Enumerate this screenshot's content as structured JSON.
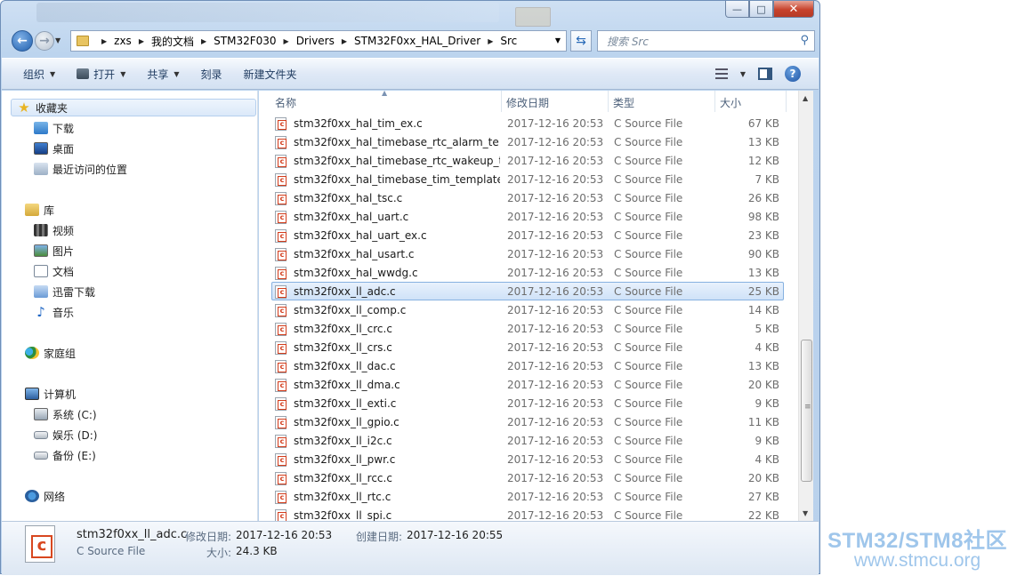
{
  "window": {
    "buttons": {
      "minimize": "—",
      "maximize": "□",
      "close": "✕"
    }
  },
  "nav": {
    "breadcrumbs": [
      "zxs",
      "我的文档",
      "STM32F030",
      "Drivers",
      "STM32F0xx_HAL_Driver",
      "Src"
    ],
    "search_placeholder": "搜索 Src"
  },
  "toolbar": {
    "organize": "组织",
    "open": "打开",
    "share": "共享",
    "burn": "刻录",
    "new_folder": "新建文件夹"
  },
  "sidebar": {
    "favorites": "收藏夹",
    "downloads": "下载",
    "desktop": "桌面",
    "recent": "最近访问的位置",
    "libraries": "库",
    "videos": "视频",
    "pictures": "图片",
    "documents": "文档",
    "xunlei": "迅雷下载",
    "music": "音乐",
    "homegroup": "家庭组",
    "computer": "计算机",
    "drive_c": "系统 (C:)",
    "drive_d": "娱乐 (D:)",
    "drive_e": "备份 (E:)",
    "network": "网络"
  },
  "columns": {
    "name": "名称",
    "date": "修改日期",
    "type": "类型",
    "size": "大小"
  },
  "files": [
    {
      "name": "stm32f0xx_hal_tim_ex.c",
      "date": "2017-12-16 20:53",
      "type": "C Source File",
      "size": "67 KB"
    },
    {
      "name": "stm32f0xx_hal_timebase_rtc_alarm_te...",
      "date": "2017-12-16 20:53",
      "type": "C Source File",
      "size": "13 KB"
    },
    {
      "name": "stm32f0xx_hal_timebase_rtc_wakeup_t...",
      "date": "2017-12-16 20:53",
      "type": "C Source File",
      "size": "12 KB"
    },
    {
      "name": "stm32f0xx_hal_timebase_tim_template.c",
      "date": "2017-12-16 20:53",
      "type": "C Source File",
      "size": "7 KB"
    },
    {
      "name": "stm32f0xx_hal_tsc.c",
      "date": "2017-12-16 20:53",
      "type": "C Source File",
      "size": "26 KB"
    },
    {
      "name": "stm32f0xx_hal_uart.c",
      "date": "2017-12-16 20:53",
      "type": "C Source File",
      "size": "98 KB"
    },
    {
      "name": "stm32f0xx_hal_uart_ex.c",
      "date": "2017-12-16 20:53",
      "type": "C Source File",
      "size": "23 KB"
    },
    {
      "name": "stm32f0xx_hal_usart.c",
      "date": "2017-12-16 20:53",
      "type": "C Source File",
      "size": "90 KB"
    },
    {
      "name": "stm32f0xx_hal_wwdg.c",
      "date": "2017-12-16 20:53",
      "type": "C Source File",
      "size": "13 KB"
    },
    {
      "name": "stm32f0xx_ll_adc.c",
      "date": "2017-12-16 20:53",
      "type": "C Source File",
      "size": "25 KB",
      "selected": true
    },
    {
      "name": "stm32f0xx_ll_comp.c",
      "date": "2017-12-16 20:53",
      "type": "C Source File",
      "size": "14 KB"
    },
    {
      "name": "stm32f0xx_ll_crc.c",
      "date": "2017-12-16 20:53",
      "type": "C Source File",
      "size": "5 KB"
    },
    {
      "name": "stm32f0xx_ll_crs.c",
      "date": "2017-12-16 20:53",
      "type": "C Source File",
      "size": "4 KB"
    },
    {
      "name": "stm32f0xx_ll_dac.c",
      "date": "2017-12-16 20:53",
      "type": "C Source File",
      "size": "13 KB"
    },
    {
      "name": "stm32f0xx_ll_dma.c",
      "date": "2017-12-16 20:53",
      "type": "C Source File",
      "size": "20 KB"
    },
    {
      "name": "stm32f0xx_ll_exti.c",
      "date": "2017-12-16 20:53",
      "type": "C Source File",
      "size": "9 KB"
    },
    {
      "name": "stm32f0xx_ll_gpio.c",
      "date": "2017-12-16 20:53",
      "type": "C Source File",
      "size": "11 KB"
    },
    {
      "name": "stm32f0xx_ll_i2c.c",
      "date": "2017-12-16 20:53",
      "type": "C Source File",
      "size": "9 KB"
    },
    {
      "name": "stm32f0xx_ll_pwr.c",
      "date": "2017-12-16 20:53",
      "type": "C Source File",
      "size": "4 KB"
    },
    {
      "name": "stm32f0xx_ll_rcc.c",
      "date": "2017-12-16 20:53",
      "type": "C Source File",
      "size": "20 KB"
    },
    {
      "name": "stm32f0xx_ll_rtc.c",
      "date": "2017-12-16 20:53",
      "type": "C Source File",
      "size": "27 KB"
    },
    {
      "name": "stm32f0xx_ll_spi.c",
      "date": "2017-12-16 20:53",
      "type": "C Source File",
      "size": "22 KB"
    }
  ],
  "details": {
    "filename": "stm32f0xx_ll_adc.c",
    "filetype": "C Source File",
    "modified_label": "修改日期:",
    "modified_value": "2017-12-16 20:53",
    "created_label": "创建日期:",
    "created_value": "2017-12-16 20:55",
    "size_label": "大小:",
    "size_value": "24.3 KB"
  },
  "watermark": {
    "line1": "STM32/STM8社区",
    "line2": "www.stmcu.org"
  }
}
